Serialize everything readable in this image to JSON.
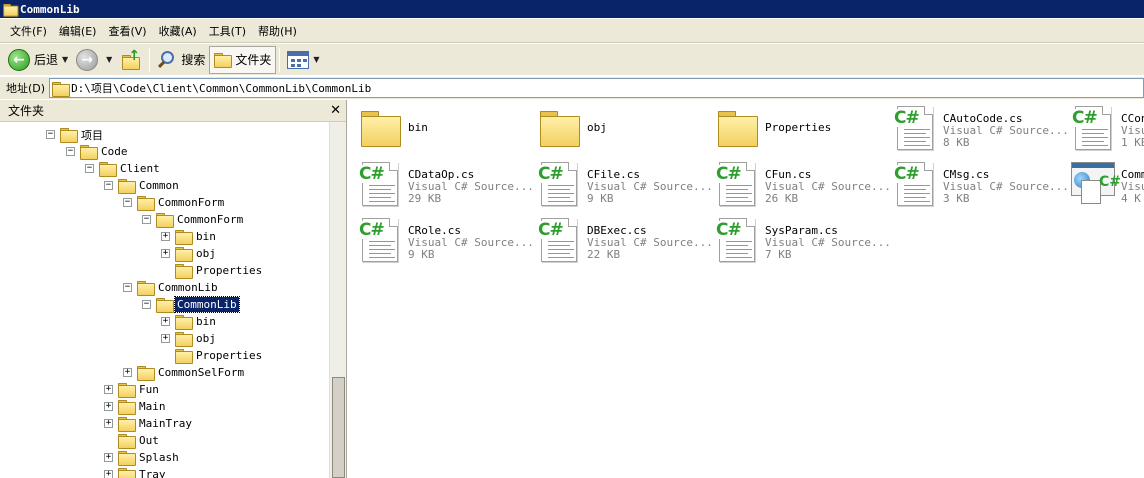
{
  "window": {
    "title": "CommonLib"
  },
  "menu": [
    "文件(F)",
    "编辑(E)",
    "查看(V)",
    "收藏(A)",
    "工具(T)",
    "帮助(H)"
  ],
  "toolbar": {
    "back": "后退",
    "search": "搜索",
    "folders": "文件夹"
  },
  "address": {
    "label": "地址(D)",
    "value": "D:\\项目\\Code\\Client\\Common\\CommonLib\\CommonLib"
  },
  "folder_pane": {
    "title": "文件夹",
    "close": "✕"
  },
  "tree": [
    {
      "label": "项目",
      "expander": "−"
    },
    {
      "label": "Code",
      "expander": "−"
    },
    {
      "label": "Client",
      "expander": "−"
    },
    {
      "label": "Common",
      "expander": "−"
    },
    {
      "label": "CommonForm",
      "expander": "−"
    },
    {
      "label": "CommonForm",
      "expander": "−"
    },
    {
      "label": "bin",
      "expander": "+"
    },
    {
      "label": "obj",
      "expander": "+"
    },
    {
      "label": "Properties",
      "expander": ""
    },
    {
      "label": "CommonLib",
      "expander": "−"
    },
    {
      "label": "CommonLib",
      "expander": "−",
      "selected": true
    },
    {
      "label": "bin",
      "expander": "+"
    },
    {
      "label": "obj",
      "expander": "+"
    },
    {
      "label": "Properties",
      "expander": ""
    },
    {
      "label": "CommonSelForm",
      "expander": "+"
    },
    {
      "label": "Fun",
      "expander": "+"
    },
    {
      "label": "Main",
      "expander": "+"
    },
    {
      "label": "MainTray",
      "expander": "+"
    },
    {
      "label": "Out",
      "expander": ""
    },
    {
      "label": "Splash",
      "expander": "+"
    },
    {
      "label": "Tray",
      "expander": "+"
    }
  ],
  "files": [
    {
      "name": "bin",
      "type": "",
      "size": "",
      "icon": "folder-icon"
    },
    {
      "name": "obj",
      "type": "",
      "size": "",
      "icon": "folder-icon"
    },
    {
      "name": "Properties",
      "type": "",
      "size": "",
      "icon": "folder-icon"
    },
    {
      "name": "CAutoCode.cs",
      "type": "Visual C# Source...",
      "size": "8 KB",
      "icon": "csharp-file-icon"
    },
    {
      "name": "CCon",
      "type": "Visu",
      "size": "1 KB",
      "icon": "csharp-file-icon"
    },
    {
      "name": "CDataOp.cs",
      "type": "Visual C# Source...",
      "size": "29 KB",
      "icon": "csharp-file-icon"
    },
    {
      "name": "CFile.cs",
      "type": "Visual C# Source...",
      "size": "9 KB",
      "icon": "csharp-file-icon"
    },
    {
      "name": "CFun.cs",
      "type": "Visual C# Source...",
      "size": "26 KB",
      "icon": "csharp-file-icon"
    },
    {
      "name": "CMsg.cs",
      "type": "Visual C# Source...",
      "size": "3 KB",
      "icon": "csharp-file-icon"
    },
    {
      "name": "Comm",
      "type": "Visu",
      "size": "4 K",
      "icon": "csharp-webform-icon"
    },
    {
      "name": "CRole.cs",
      "type": "Visual C# Source...",
      "size": "9 KB",
      "icon": "csharp-file-icon"
    },
    {
      "name": "DBExec.cs",
      "type": "Visual C# Source...",
      "size": "22 KB",
      "icon": "csharp-file-icon"
    },
    {
      "name": "SysParam.cs",
      "type": "Visual C# Source...",
      "size": "7 KB",
      "icon": "csharp-file-icon"
    }
  ]
}
